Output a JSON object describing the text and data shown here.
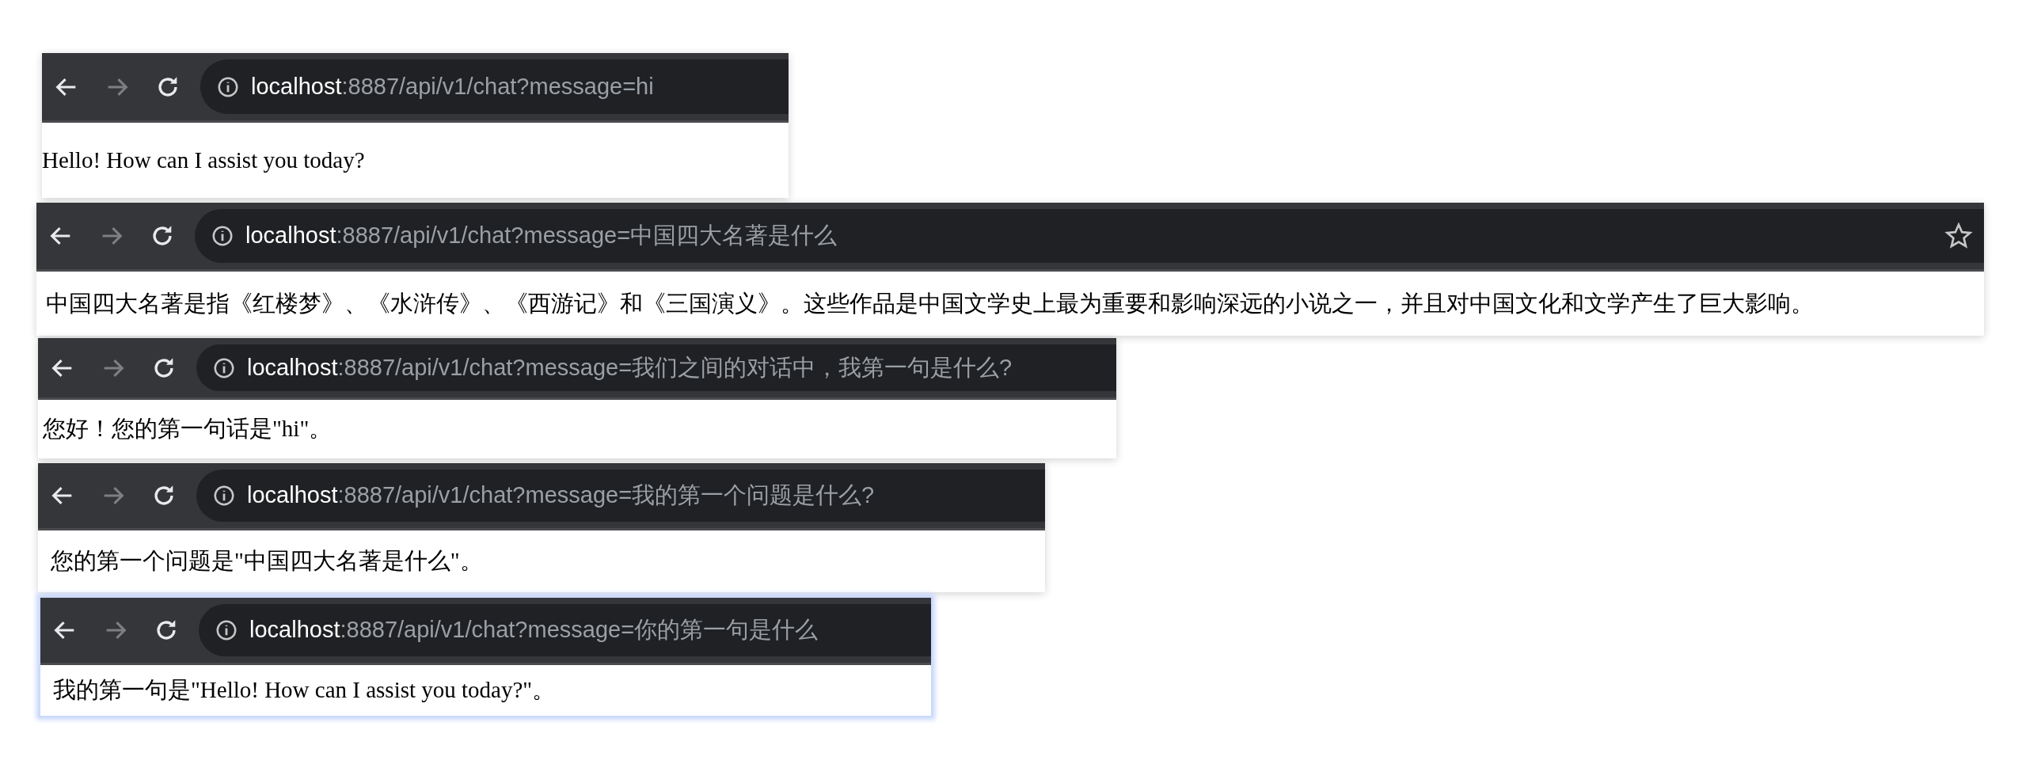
{
  "windows": [
    {
      "host": "localhost",
      "path": ":8887/api/v1/chat?message=hi",
      "response": "Hello! How can I assist you today?",
      "bookmark_star": false,
      "focused": false
    },
    {
      "host": "localhost",
      "path": ":8887/api/v1/chat?message=中国四大名著是什么",
      "response": "中国四大名著是指《红楼梦》、《水浒传》、《西游记》和《三国演义》。这些作品是中国文学史上最为重要和影响深远的小说之一，并且对中国文化和文学产生了巨大影响。",
      "bookmark_star": true,
      "focused": false
    },
    {
      "host": "localhost",
      "path": ":8887/api/v1/chat?message=我们之间的对话中，我第一句是什么?",
      "response": "您好！您的第一句话是\"hi\"。",
      "bookmark_star": false,
      "focused": false
    },
    {
      "host": "localhost",
      "path": ":8887/api/v1/chat?message=我的第一个问题是什么?",
      "response": "您的第一个问题是\"中国四大名著是什么\"。",
      "bookmark_star": false,
      "focused": false
    },
    {
      "host": "localhost",
      "path": ":8887/api/v1/chat?message=你的第一句是什么",
      "response": "我的第一句是\"Hello! How can I assist you today?\"。",
      "bookmark_star": false,
      "focused": true
    }
  ]
}
